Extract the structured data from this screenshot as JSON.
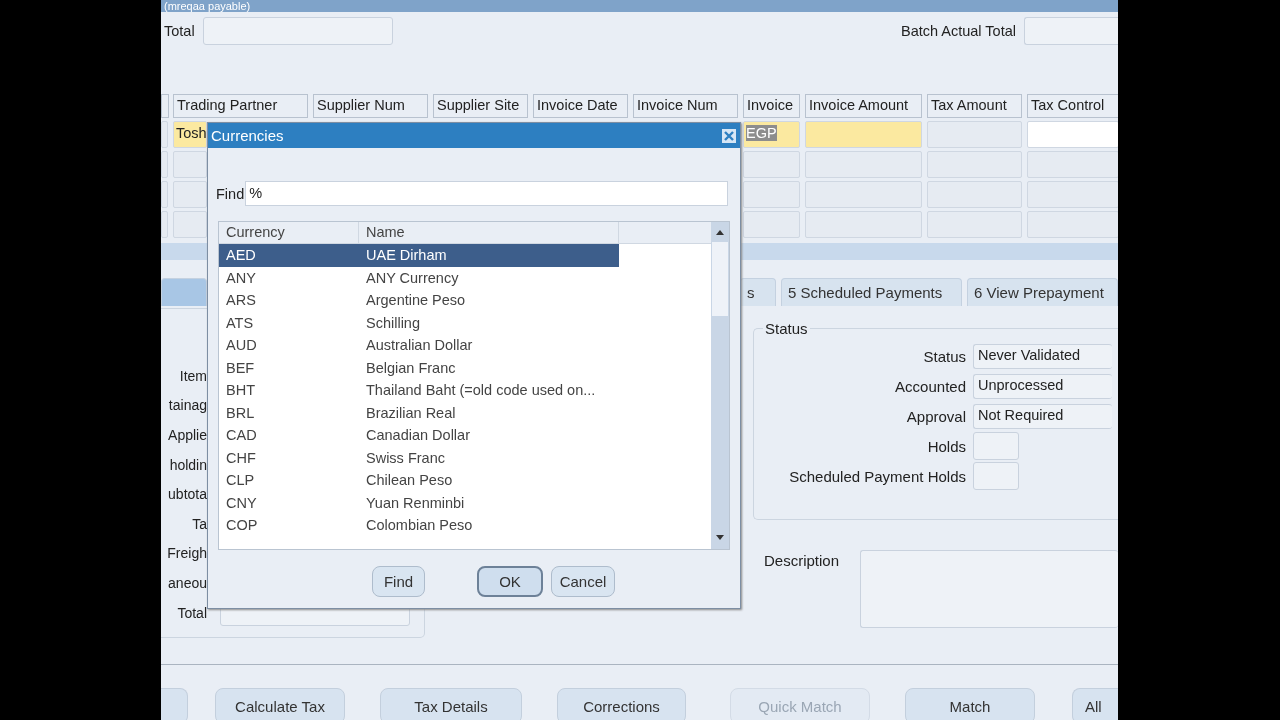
{
  "window": {
    "title": "(mreqaa payable)"
  },
  "header": {
    "total_label": "Total",
    "batch_total_label": "Batch Actual Total"
  },
  "lines_table": {
    "columns": [
      {
        "label": "Trading Partner",
        "required": true
      },
      {
        "label": "Supplier Num"
      },
      {
        "label": "Supplier Site"
      },
      {
        "label": "Invoice Date"
      },
      {
        "label": "Invoice Num"
      },
      {
        "label": "Invoice",
        "required": true
      },
      {
        "label": "Invoice Amount",
        "required": true
      },
      {
        "label": "Tax Amount",
        "editable": false
      },
      {
        "label": "Tax Control",
        "editable": true
      }
    ],
    "rows": [
      {
        "current": true,
        "trading_partner": "Tosh",
        "invoice_currency": "EGP",
        "currency_highlighted": true
      },
      {
        "current": false
      },
      {
        "current": false
      },
      {
        "current": false
      }
    ]
  },
  "tabs": [
    {
      "selected": true
    },
    {
      "label": "s",
      "selected": false
    },
    {
      "label": "5 Scheduled Payments",
      "selected": false
    },
    {
      "label": "6 View Prepayment",
      "selected": false
    }
  ],
  "totals_panel": {
    "labels": [
      "Item",
      "tainag",
      "Applie",
      "holdin",
      "ubtota",
      "Ta",
      "Freigh",
      "aneou"
    ],
    "total_label": "Total"
  },
  "status_group": {
    "title": "Status",
    "fields": [
      {
        "label": "Status",
        "value": "Never Validated",
        "kind": "wide"
      },
      {
        "label": "Accounted",
        "value": "Unprocessed",
        "kind": "wide"
      },
      {
        "label": "Approval",
        "value": "Not Required",
        "kind": "wide"
      },
      {
        "label": "Holds",
        "kind": "short"
      },
      {
        "label": "Scheduled Payment Holds",
        "kind": "short"
      }
    ]
  },
  "description": {
    "label": "Description"
  },
  "buttons": [
    {
      "disabled": false
    },
    {
      "label": "Calculate Tax",
      "disabled": false
    },
    {
      "label": "Tax Details",
      "disabled": false
    },
    {
      "label": "Corrections",
      "disabled": false
    },
    {
      "label": "Quick Match",
      "disabled": true
    },
    {
      "label": "Match",
      "disabled": false
    },
    {
      "label": "All",
      "disabled": false
    }
  ],
  "dialog": {
    "title": "Currencies",
    "find_label": "Find",
    "find_value": "%",
    "columns": [
      "Currency",
      "Name"
    ],
    "rows": [
      {
        "code": "AED",
        "name": "UAE Dirham",
        "selected": true
      },
      {
        "code": "ANY",
        "name": "ANY Currency",
        "selected": false
      },
      {
        "code": "ARS",
        "name": "Argentine Peso",
        "selected": false
      },
      {
        "code": "ATS",
        "name": "Schilling",
        "selected": false
      },
      {
        "code": "AUD",
        "name": "Australian Dollar",
        "selected": false
      },
      {
        "code": "BEF",
        "name": "Belgian Franc",
        "selected": false
      },
      {
        "code": "BHT",
        "name": "Thailand Baht (=old code used on...",
        "selected": false
      },
      {
        "code": "BRL",
        "name": "Brazilian Real",
        "selected": false
      },
      {
        "code": "CAD",
        "name": "Canadian Dollar",
        "selected": false
      },
      {
        "code": "CHF",
        "name": "Swiss Franc",
        "selected": false
      },
      {
        "code": "CLP",
        "name": "Chilean Peso",
        "selected": false
      },
      {
        "code": "CNY",
        "name": "Yuan Renminbi",
        "selected": false
      },
      {
        "code": "COP",
        "name": "Colombian Peso",
        "selected": false
      }
    ],
    "buttons": [
      {
        "label": "Find",
        "default": false
      },
      {
        "label": "OK",
        "default": true
      },
      {
        "label": "Cancel",
        "default": false
      }
    ]
  }
}
